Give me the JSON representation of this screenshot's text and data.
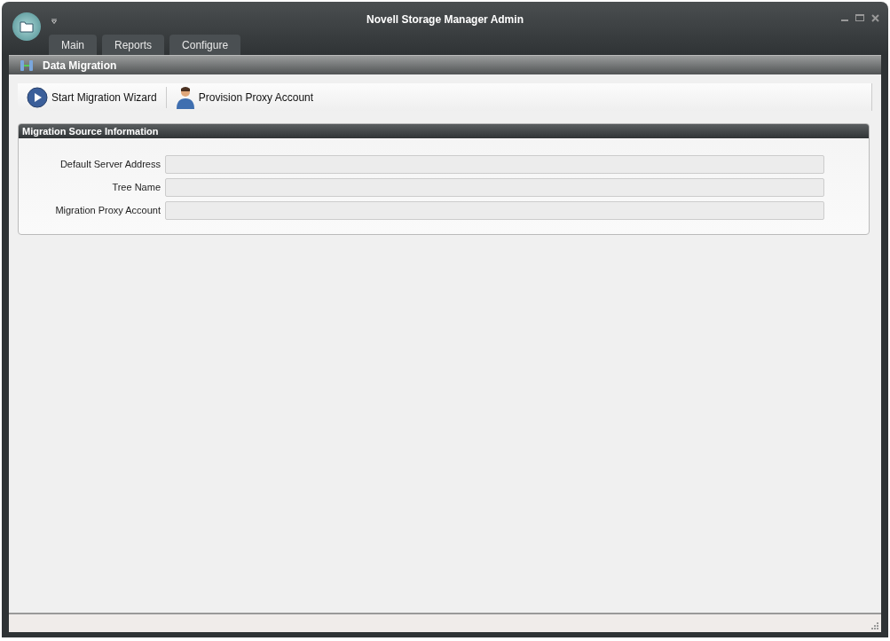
{
  "window": {
    "title": "Novell Storage Manager Admin"
  },
  "tabs": [
    {
      "label": "Main"
    },
    {
      "label": "Reports"
    },
    {
      "label": "Configure"
    }
  ],
  "section": {
    "title": "Data Migration"
  },
  "toolbar": [
    {
      "kind": "play",
      "label": "Start Migration Wizard"
    },
    {
      "kind": "person",
      "label": "Provision Proxy Account"
    }
  ],
  "group": {
    "title": "Migration Source Information",
    "fields": [
      {
        "label": "Default Server Address"
      },
      {
        "label": "Tree Name"
      },
      {
        "label": "Migration Proxy Account"
      }
    ]
  }
}
